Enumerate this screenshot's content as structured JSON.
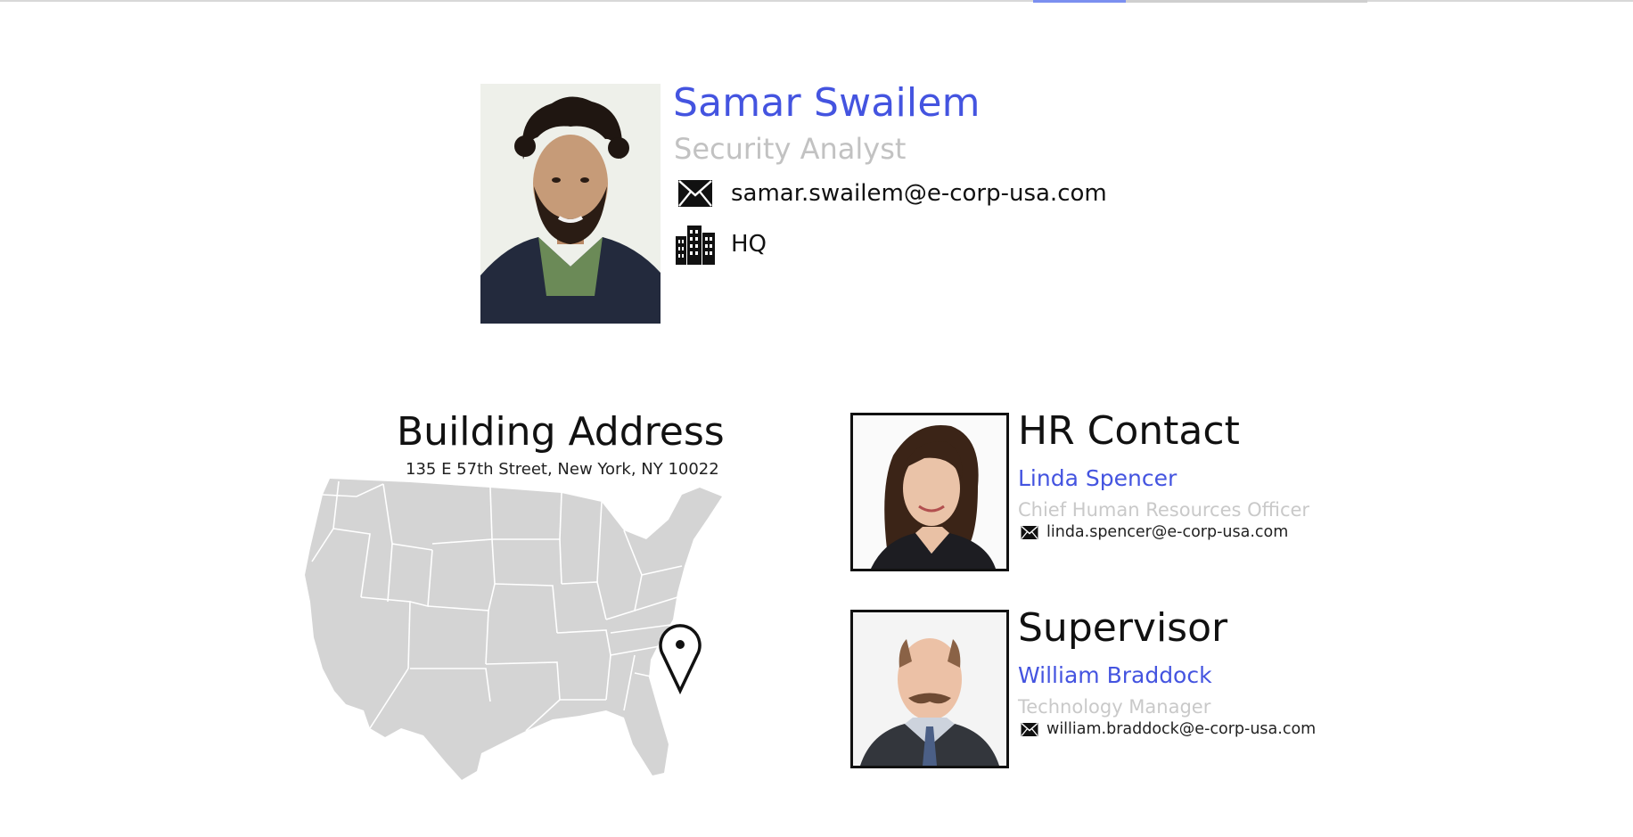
{
  "profile": {
    "name": "Samar Swailem",
    "title": "Security Analyst",
    "email": "samar.swailem@e-corp-usa.com",
    "office": "HQ",
    "email_icon": "envelope-icon",
    "office_icon": "buildings-icon"
  },
  "building": {
    "heading": "Building Address",
    "address": "135 E 57th Street, New York, NY 10022",
    "map_icon": "map-pin-icon"
  },
  "hr_contact": {
    "heading": "HR Contact",
    "name": "Linda Spencer",
    "title": "Chief Human Resources Officer",
    "email": "linda.spencer@e-corp-usa.com"
  },
  "supervisor": {
    "heading": "Supervisor",
    "name": "William Braddock",
    "title": "Technology Manager",
    "email": "william.braddock@e-corp-usa.com"
  },
  "colors": {
    "accent": "#4454e0",
    "muted": "#c2c2c2",
    "map": "#d4d4d4"
  }
}
